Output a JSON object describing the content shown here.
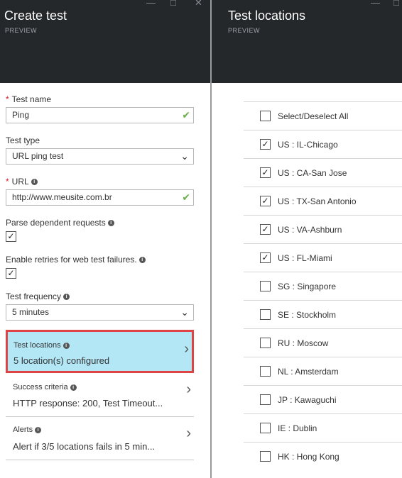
{
  "left": {
    "title": "Create test",
    "subtitle": "PREVIEW",
    "test_name": {
      "label": "Test name",
      "value": "Ping"
    },
    "test_type": {
      "label": "Test type",
      "value": "URL ping test"
    },
    "url": {
      "label": "URL",
      "value": "http://www.meusite.com.br"
    },
    "parse": {
      "label": "Parse dependent requests",
      "checked": true
    },
    "retries": {
      "label": "Enable retries for web test failures.",
      "checked": true
    },
    "frequency": {
      "label": "Test frequency",
      "value": "5 minutes"
    },
    "rows": [
      {
        "label": "Test locations",
        "value": "5 location(s) configured"
      },
      {
        "label": "Success criteria",
        "value": "HTTP response: 200, Test Timeout..."
      },
      {
        "label": "Alerts",
        "value": "Alert if 3/5 locations fails in 5 min..."
      }
    ]
  },
  "right": {
    "title": "Test locations",
    "subtitle": "PREVIEW",
    "select_all": "Select/Deselect All",
    "locations": [
      {
        "name": "US : IL-Chicago",
        "checked": true
      },
      {
        "name": "US : CA-San Jose",
        "checked": true
      },
      {
        "name": "US : TX-San Antonio",
        "checked": true
      },
      {
        "name": "US : VA-Ashburn",
        "checked": true
      },
      {
        "name": "US : FL-Miami",
        "checked": true
      },
      {
        "name": "SG : Singapore",
        "checked": false
      },
      {
        "name": "SE : Stockholm",
        "checked": false
      },
      {
        "name": "RU : Moscow",
        "checked": false
      },
      {
        "name": "NL : Amsterdam",
        "checked": false
      },
      {
        "name": "JP : Kawaguchi",
        "checked": false
      },
      {
        "name": "IE : Dublin",
        "checked": false
      },
      {
        "name": "HK : Hong Kong",
        "checked": false
      }
    ]
  },
  "colors": {
    "header": "#25282b",
    "selected_row": "#b3e7f6",
    "highlight_border": "#e04343",
    "valid_check": "#6ab04c",
    "required": "#e81123"
  }
}
